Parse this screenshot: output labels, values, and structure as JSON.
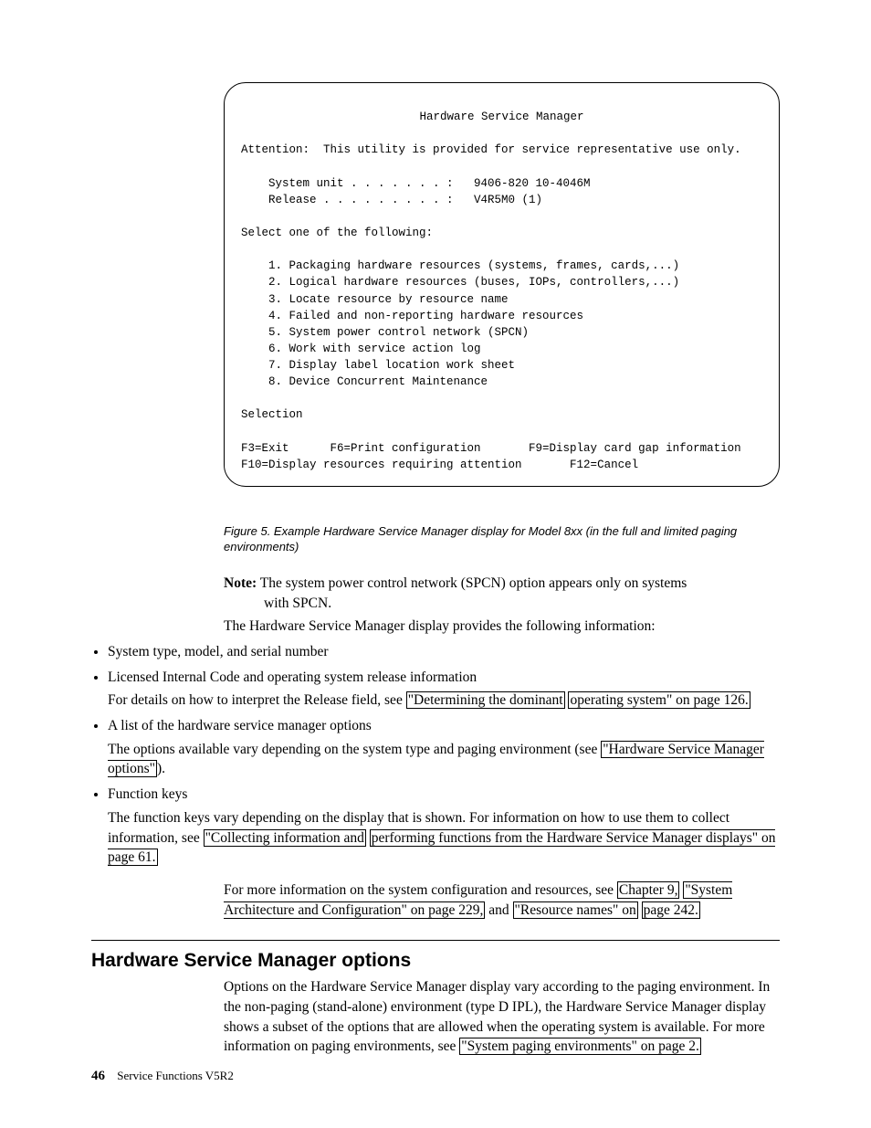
{
  "terminal": {
    "title": "Hardware Service Manager",
    "attention": "Attention:  This utility is provided for service representative use only.",
    "sysunit_label": "    System unit . . . . . . . :   9406-820 10-4046M",
    "release_label": "    Release . . . . . . . . . :   V4R5M0 (1)",
    "select": "Select one of the following:",
    "opt1": "    1. Packaging hardware resources (systems, frames, cards,...)",
    "opt2": "    2. Logical hardware resources (buses, IOPs, controllers,...)",
    "opt3": "    3. Locate resource by resource name",
    "opt4": "    4. Failed and non-reporting hardware resources",
    "opt5": "    5. System power control network (SPCN)",
    "opt6": "    6. Work with service action log",
    "opt7": "    7. Display label location work sheet",
    "opt8": "    8. Device Concurrent Maintenance",
    "selection": "Selection",
    "fk1": "F3=Exit      F6=Print configuration       F9=Display card gap information",
    "fk2": "F10=Display resources requiring attention       F12=Cancel"
  },
  "figcap": "Figure 5. Example Hardware Service Manager display for Model 8xx (in the full and limited paging environments)",
  "note": {
    "label": "Note:",
    "line1": "The system power control network (SPCN) option appears only on systems",
    "line2": "with SPCN."
  },
  "intro": "The Hardware Service Manager display provides the following information:",
  "bullets": {
    "b1": "System type, model, and serial number",
    "b2": "Licensed Internal Code and operating system release information",
    "b2sub_pre": "For details on how to interpret the Release field, see ",
    "b2link1": "\"Determining the dominant",
    "b2link2": "operating system\" on page 126.",
    "b3": "A list of the hardware service manager options",
    "b3sub_pre": "The options available vary depending on the system type and paging environment (see ",
    "b3link": "\"Hardware Service Manager options\"",
    "b3post": ").",
    "b4": "Function keys",
    "b4sub_pre": "The function keys vary depending on the display that is shown. For information on how to use them to collect information, see ",
    "b4link1": "\"Collecting information and",
    "b4link2": "performing functions from the Hardware Service Manager displays\" on page 61."
  },
  "morepara_pre": "For more information on the system configuration and resources, see ",
  "morelink1a": "Chapter 9,",
  "morelink1b": "\"System Architecture and Configuration\" on page 229,",
  "more_mid": " and ",
  "morelink2a": "\"Resource names\" on",
  "morelink2b": "page 242.",
  "sectiontitle": "Hardware Service Manager options",
  "sectionbody_pre": "Options on the Hardware Service Manager display vary according to the paging environment. In the non-paging (stand-alone) environment (type D IPL), the Hardware Service Manager display shows a subset of the options that are allowed when the operating system is available. For more information on paging environments, see ",
  "sectionlink": "\"System paging environments\" on page 2.",
  "footer": {
    "pagenum": "46",
    "booktitle": "Service Functions V5R2"
  }
}
